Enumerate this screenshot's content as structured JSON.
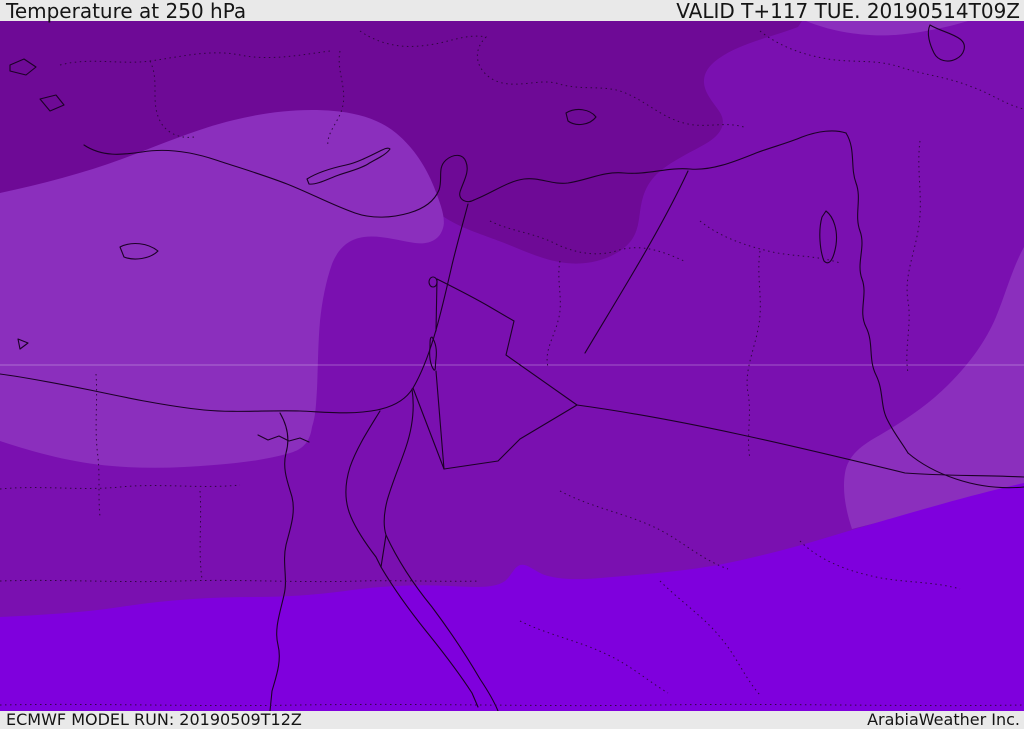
{
  "header": {
    "title": "Temperature at 250 hPa",
    "valid": "VALID T+117 TUE. 20190514T09Z"
  },
  "footer": {
    "model_run": "ECMWF MODEL RUN: 20190509T12Z",
    "brand": "ArabiaWeather Inc."
  },
  "map": {
    "region": "Middle East / Eastern Mediterranean",
    "bands": [
      {
        "position": "north",
        "color": "#6e0a96"
      },
      {
        "position": "central-base",
        "color": "#7a10b0"
      },
      {
        "position": "mediterranean-and-southeast-patches",
        "color": "#8b2fbd"
      },
      {
        "position": "south",
        "color": "#7f00dd"
      }
    ]
  },
  "colors": {
    "bar_bg": "#e9e9e9",
    "bar_text": "#151515",
    "band_dark": "#6e0a96",
    "band_base": "#7a10b0",
    "band_light": "#8b2fbd",
    "band_violet": "#7f00dd",
    "border_line": "#1c0126",
    "admin_line": "#2a0638",
    "gridline": "rgba(255,255,255,0.30)"
  }
}
